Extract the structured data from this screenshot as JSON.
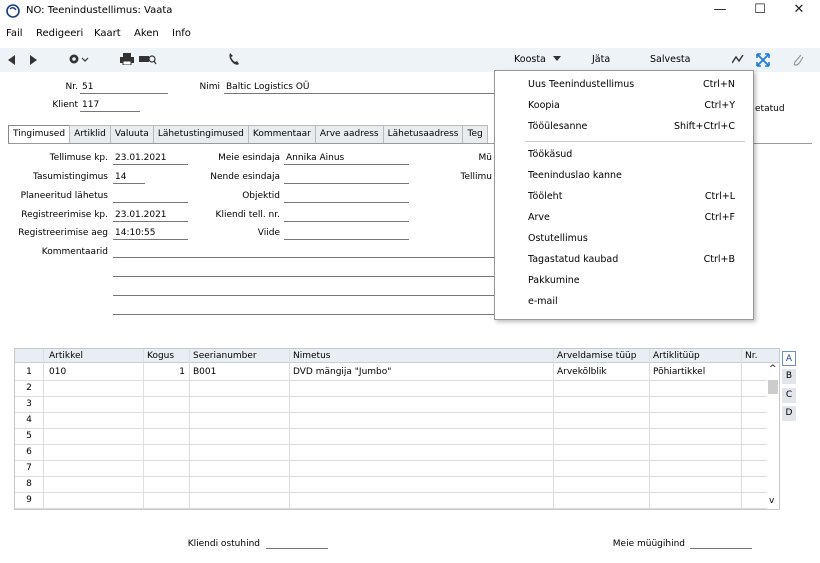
{
  "window": {
    "title": "NO: Teenindustellimus: Vaata",
    "controls": {
      "minimize": "—",
      "maximize": "☐",
      "close": "✕"
    }
  },
  "menu": [
    "Fail",
    "Redigeeri",
    "Kaart",
    "Aken",
    "Info"
  ],
  "toolbar": {
    "koosta_label": "Koosta",
    "jata_label": "Jäta",
    "salvesta_label": "Salvesta"
  },
  "header": {
    "nr_label": "Nr.",
    "nr_value": "51",
    "nimi_label": "Nimi",
    "nimi_value": "Baltic Logistics OÜ",
    "klient_label": "Klient",
    "klient_value": "117",
    "partial_right": "etatud"
  },
  "tabs": [
    "Tingimused",
    "Artiklid",
    "Valuuta",
    "Lähetustingimused",
    "Kommentaar",
    "Arve aadress",
    "Lähetusaadress",
    "Teg"
  ],
  "form": {
    "tellimuse_kp_label": "Tellimuse kp.",
    "tellimuse_kp_value": "23.01.2021",
    "tasumistingimus_label": "Tasumistingimus",
    "tasumistingimus_value": "14",
    "planeeritud_label": "Planeeritud lähetus",
    "registreerimise_kp_label": "Registreerimise kp.",
    "registreerimise_kp_value": "23.01.2021",
    "registreerimise_aeg_label": "Registreerimise aeg",
    "registreerimise_aeg_value": "14:10:55",
    "kommentaarid_label": "Kommentaarid",
    "meie_esindaja_label": "Meie esindaja",
    "meie_esindaja_value": "Annika Ainus",
    "nende_esindaja_label": "Nende esindaja",
    "objektid_label": "Objektid",
    "kliendi_tell_label": "Kliendi tell. nr.",
    "viide_label": "Viide",
    "partial_mu": "Mü",
    "partial_tellimu": "Tellimu"
  },
  "dropdown": {
    "items": [
      {
        "label": "Uus Teenindustellimus",
        "shortcut": "Ctrl+N"
      },
      {
        "label": "Koopia",
        "shortcut": "Ctrl+Y"
      },
      {
        "label": "Tööülesanne",
        "shortcut": "Shift+Ctrl+C"
      },
      {
        "label": "Töökäsud",
        "shortcut": ""
      },
      {
        "label": "Teeninduslao kanne",
        "shortcut": ""
      },
      {
        "label": "Tööleht",
        "shortcut": "Ctrl+L"
      },
      {
        "label": "Arve",
        "shortcut": "Ctrl+F"
      },
      {
        "label": "Ostutellimus",
        "shortcut": ""
      },
      {
        "label": "Tagastatud kaubad",
        "shortcut": "Ctrl+B"
      },
      {
        "label": "Pakkumine",
        "shortcut": ""
      },
      {
        "label": "e-mail",
        "shortcut": ""
      }
    ]
  },
  "grid": {
    "columns": [
      "Artikkel",
      "Kogus",
      "Seerianumber",
      "Nimetus",
      "Arveldamise tüüp",
      "Artiklitüüp",
      "Nr."
    ],
    "row_numbers": [
      "1",
      "2",
      "3",
      "4",
      "5",
      "6",
      "7",
      "8",
      "9"
    ],
    "rows": [
      {
        "artikkel": "010",
        "kogus": "1",
        "seerianumber": "B001",
        "nimetus": "DVD mängija \"Jumbo\"",
        "arveldamise_tuup": "Arvekõlblik",
        "artiklituup": "Põhiartikkel",
        "nr": ""
      }
    ],
    "side_tabs": [
      "A",
      "B",
      "C",
      "D"
    ],
    "scroll_up": "^",
    "scroll_down": "v"
  },
  "footer": {
    "kliendi_ostuhind_label": "Kliendi ostuhind",
    "meie_muugihind_label": "Meie müügihind"
  }
}
